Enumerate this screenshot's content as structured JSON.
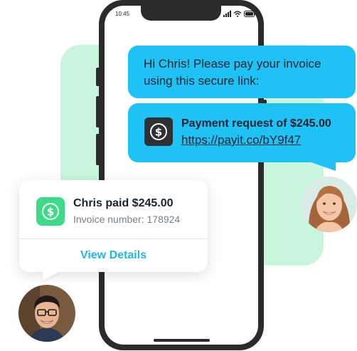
{
  "phone": {
    "status_time": "10:45"
  },
  "messages": {
    "invoice_text": "Hi Chris! Please pay your invoice using this secure link:",
    "payment_title": "Payment request of $245.00",
    "payment_link": "https://payit.co/bY9f47"
  },
  "notification": {
    "title": "Chris paid $245.00",
    "subtitle": "Invoice number: 178924",
    "action_label": "View Details"
  },
  "colors": {
    "bubble_blue": "#1fc2f5",
    "accent_green": "#3fd98a",
    "mint_background": "#c9f5dd",
    "phone_frame": "#2b2b2d",
    "link_blue": "#1fb6ec"
  },
  "icons": {
    "payment_icon": "dollar-circle-icon",
    "paid_icon": "dollar-circle-icon"
  }
}
